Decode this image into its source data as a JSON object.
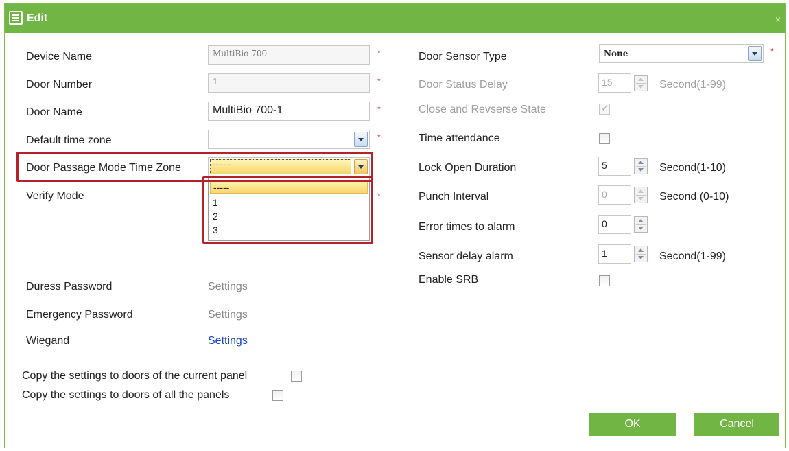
{
  "window": {
    "title": "Edit",
    "close_symbol": "×"
  },
  "left": {
    "device_name_label": "Device Name",
    "device_name_value": "MultiBio 700",
    "door_number_label": "Door Number",
    "door_number_value": "1",
    "door_name_label": "Door Name",
    "door_name_value": "MultiBio 700-1",
    "default_tz_label": "Default time zone",
    "default_tz_value": "",
    "passage_tz_label": "Door Passage Mode Time Zone",
    "passage_tz_value": "-----",
    "passage_tz_options": [
      "-----",
      "1",
      "2",
      "3"
    ],
    "verify_mode_label": "Verify Mode",
    "duress_label": "Duress Password",
    "duress_link": "Settings",
    "emergency_label": "Emergency Password",
    "emergency_link": "Settings",
    "wiegand_label": "Wiegand",
    "wiegand_link": "Settings",
    "required_mark": "*"
  },
  "right": {
    "sensor_type_label": "Door Sensor Type",
    "sensor_type_value": "None",
    "status_delay_label": "Door Status Delay",
    "status_delay_value": "15",
    "status_delay_unit": "Second(1-99)",
    "close_reverse_label": "Close and Revserse State",
    "time_attendance_label": "Time attendance",
    "lock_open_label": "Lock Open Duration",
    "lock_open_value": "5",
    "lock_open_unit": "Second(1-10)",
    "punch_interval_label": "Punch Interval",
    "punch_interval_value": "0",
    "punch_interval_unit": "Second (0-10)",
    "error_times_label": "Error times to alarm",
    "error_times_value": "0",
    "sensor_delay_label": "Sensor delay alarm",
    "sensor_delay_value": "1",
    "sensor_delay_unit": "Second(1-99)",
    "srb_label": "Enable SRB"
  },
  "copy": {
    "current_panel": "Copy the settings to doors of the current panel",
    "all_panels": "Copy the settings to doors of all the panels"
  },
  "buttons": {
    "ok": "OK",
    "cancel": "Cancel"
  },
  "colors": {
    "accent": "#71b544",
    "required": "#e0393e",
    "highlight": "#b5212a",
    "link": "#1a44c8"
  }
}
